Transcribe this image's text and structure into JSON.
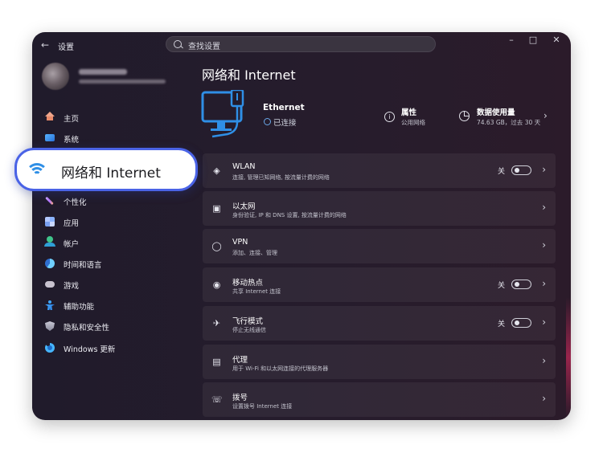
{
  "app": {
    "title": "设置",
    "back_icon": "arrow-left-icon"
  },
  "search": {
    "placeholder": "查找设置"
  },
  "sidebar": {
    "items": [
      {
        "label": "主页",
        "icon": "home-icon"
      },
      {
        "label": "系统",
        "icon": "monitor-icon"
      },
      {
        "label": "网络和 Internet",
        "icon": "wifi-icon",
        "selected": true
      },
      {
        "label": "个性化",
        "icon": "brush-icon"
      },
      {
        "label": "应用",
        "icon": "apps-icon"
      },
      {
        "label": "帐户",
        "icon": "account-icon"
      },
      {
        "label": "时间和语言",
        "icon": "globe-clock-icon"
      },
      {
        "label": "游戏",
        "icon": "gamepad-icon"
      },
      {
        "label": "辅助功能",
        "icon": "accessibility-icon"
      },
      {
        "label": "隐私和安全性",
        "icon": "shield-icon"
      },
      {
        "label": "Windows 更新",
        "icon": "update-icon"
      }
    ]
  },
  "callout": {
    "label": "网络和 Internet",
    "accent": "#4a63e6"
  },
  "main": {
    "title": "网络和 Internet",
    "ethernet": {
      "name": "Ethernet",
      "status": "已连接"
    },
    "properties": {
      "title": "属性",
      "subtitle": "公用网络"
    },
    "data_usage": {
      "title": "数据使用量",
      "subtitle": "74.63 GB，过去 30 天"
    },
    "cards": [
      {
        "title": "WLAN",
        "subtitle": "连接, 管理已知网络, 按流量计费的网络",
        "icon": "wifi-icon",
        "toggle": "关"
      },
      {
        "title": "以太网",
        "subtitle": "身份验证, IP 和 DNS 设置, 按流量计费的网络",
        "icon": "ethernet-icon"
      },
      {
        "title": "VPN",
        "subtitle": "添加、连接、管理",
        "icon": "vpn-shield-icon"
      },
      {
        "title": "移动热点",
        "subtitle": "共享 Internet 连接",
        "icon": "hotspot-icon",
        "toggle": "关"
      },
      {
        "title": "飞行模式",
        "subtitle": "停止无线通信",
        "icon": "airplane-icon",
        "toggle": "关"
      },
      {
        "title": "代理",
        "subtitle": "用于 Wi-Fi 和以太网连接的代理服务器",
        "icon": "proxy-icon"
      },
      {
        "title": "拨号",
        "subtitle": "设置拨号 Internet 连接",
        "icon": "dialup-icon"
      }
    ]
  },
  "colors": {
    "window_bg": "#221b2b",
    "accent_blue": "#2f8fe6"
  }
}
